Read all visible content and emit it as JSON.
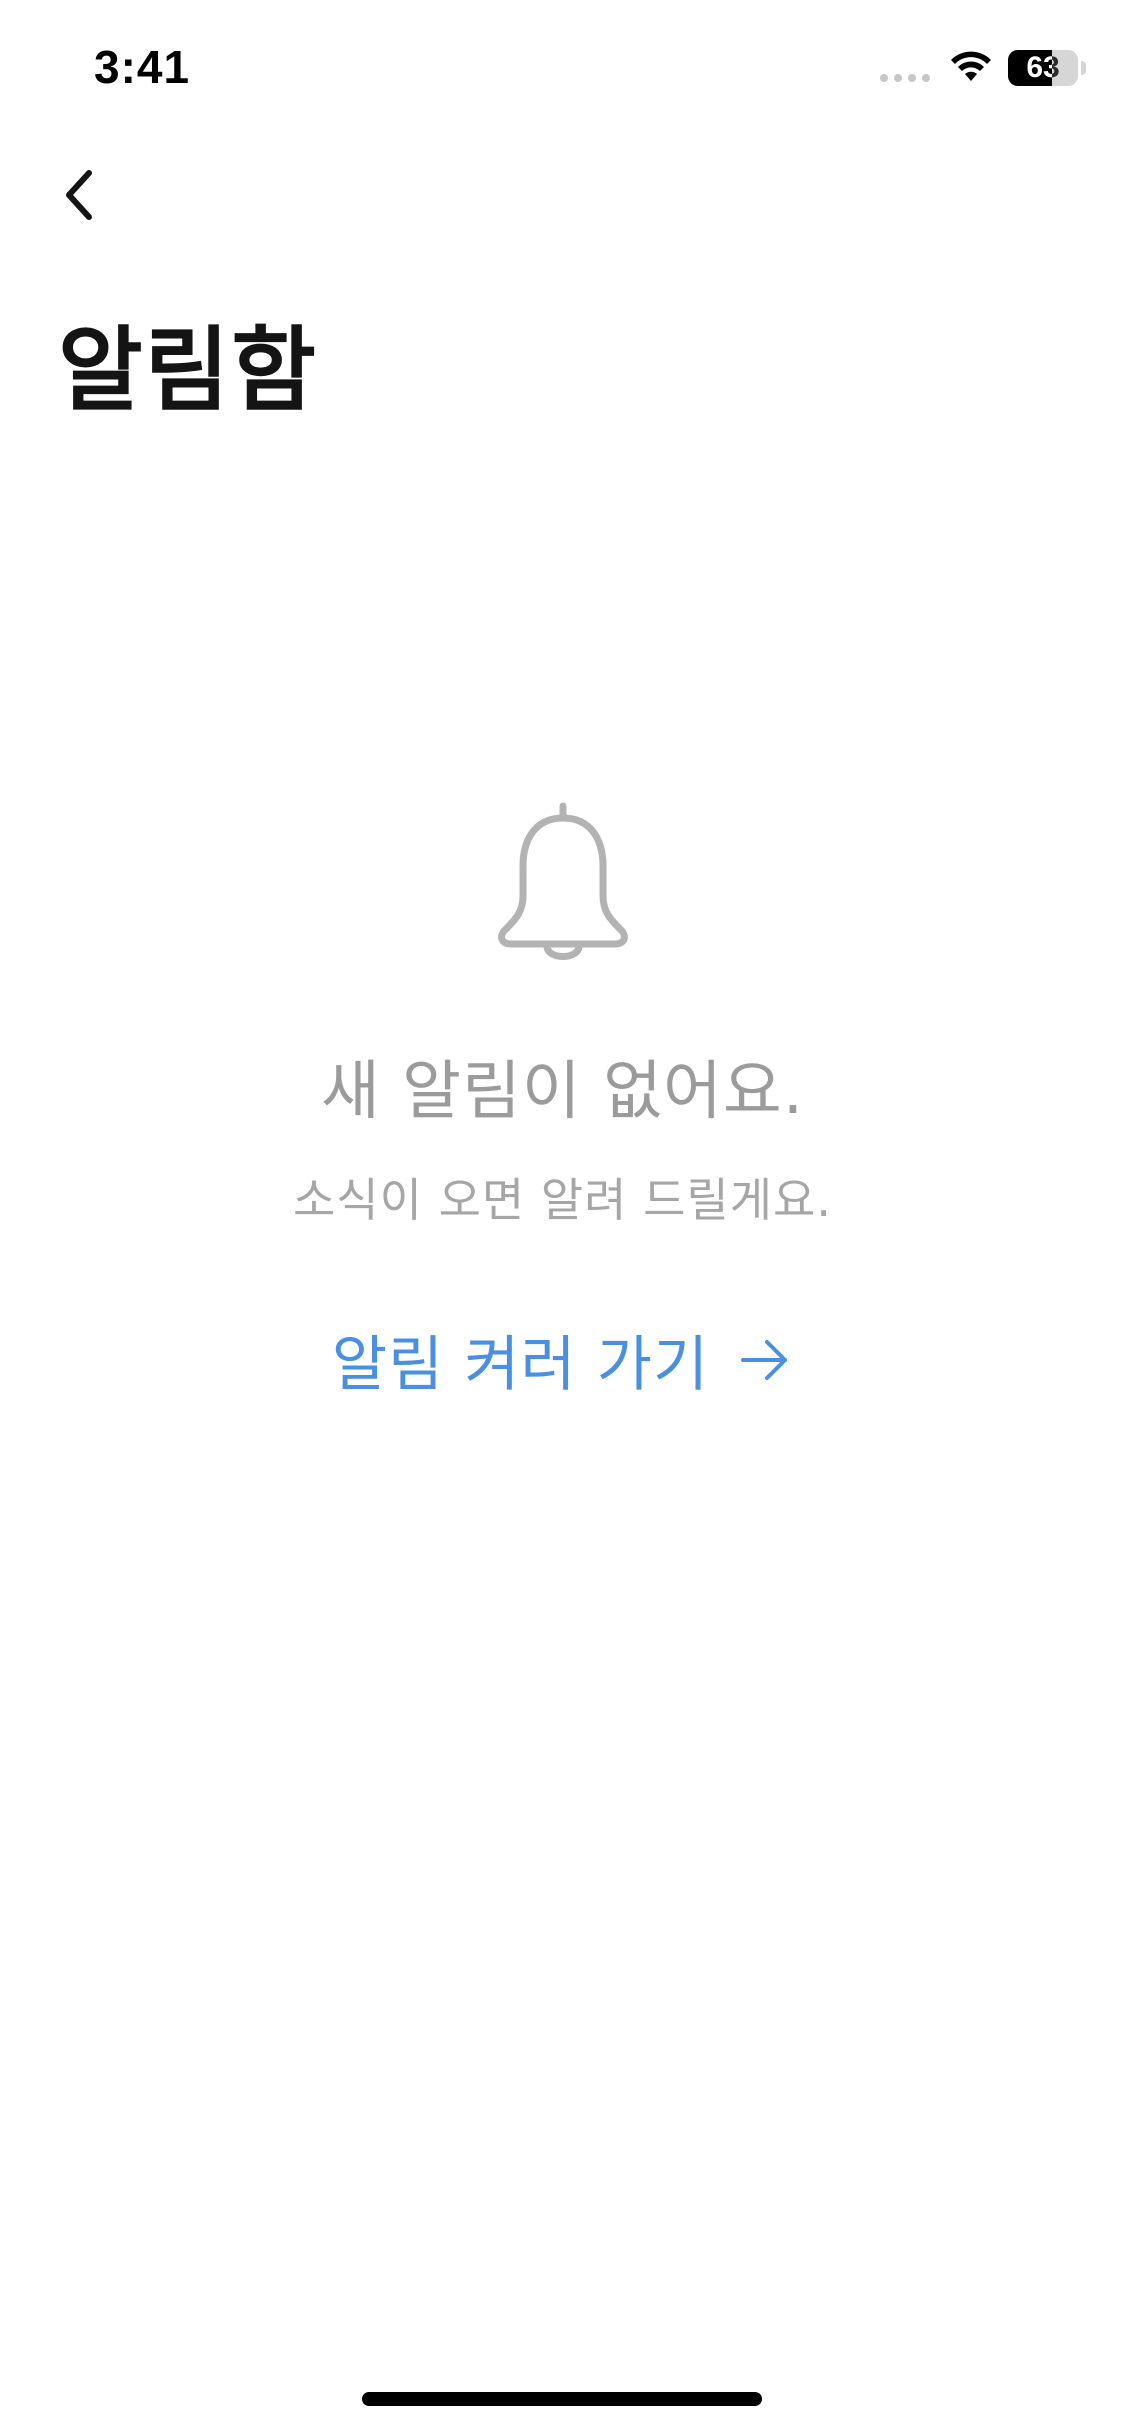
{
  "status_bar": {
    "time": "3:41",
    "battery_level": "63",
    "battery_fraction": 0.63
  },
  "header": {
    "back_icon": "chevron-left-icon",
    "title": "알림함"
  },
  "empty_state": {
    "icon": "bell-icon",
    "title": "새 알림이 없어요.",
    "subtitle": "소식이 오면 알려 드릴게요.",
    "cta_label": "알림 켜러 가기",
    "cta_icon": "arrow-right-icon"
  },
  "colors": {
    "accent": "#4a8fe2",
    "muted_text": "#9b9b9b",
    "title_text": "#141414",
    "icon_gray": "#b3b3b3"
  }
}
